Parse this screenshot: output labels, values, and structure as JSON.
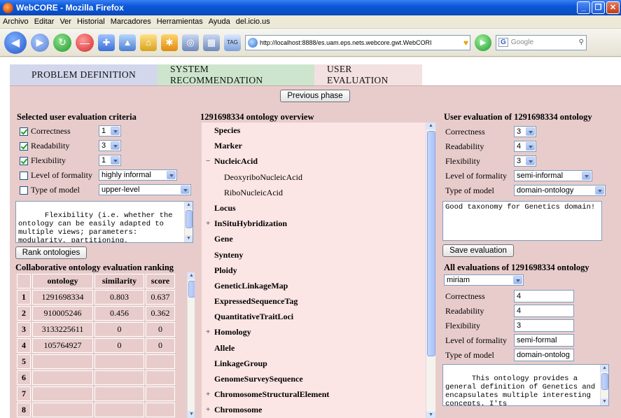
{
  "window": {
    "title": "WebCORE - Mozilla Firefox",
    "menu": [
      "Archivo",
      "Editar",
      "Ver",
      "Historial",
      "Marcadores",
      "Herramientas",
      "Ayuda",
      "del.icio.us"
    ],
    "url": "http://localhost:8888/es.uam.eps.nets.webcore.gwt.WebCORI",
    "search_placeholder": "Google",
    "tag_label": "TAG"
  },
  "tabs": [
    "PROBLEM DEFINITION",
    "SYSTEM RECOMMENDATION",
    "USER EVALUATION"
  ],
  "prev_button": "Previous phase",
  "criteria": {
    "heading": "Selected user evaluation criteria",
    "items": [
      {
        "label": "Correctness",
        "checked": true,
        "value": "1"
      },
      {
        "label": "Readability",
        "checked": true,
        "value": "3"
      },
      {
        "label": "Flexibility",
        "checked": true,
        "value": "1"
      },
      {
        "label": "Level of formality",
        "checked": false,
        "value": "highly informal"
      },
      {
        "label": "Type of model",
        "checked": false,
        "value": "upper-level"
      }
    ],
    "description": "Flexibility (i.e. whether the ontology can be easily adapted to multiple views; parameters: modularity, partitioning,",
    "rank_button": "Rank ontologies"
  },
  "ranking": {
    "heading": "Collaborative ontology evaluation ranking",
    "columns": [
      "ontology",
      "similarity",
      "score"
    ],
    "rows": [
      {
        "n": "1",
        "ontology": "1291698334",
        "similarity": "0.803",
        "score": "0.637"
      },
      {
        "n": "2",
        "ontology": "910005246",
        "similarity": "0.456",
        "score": "0.362"
      },
      {
        "n": "3",
        "ontology": "3133225611",
        "similarity": "0",
        "score": "0"
      },
      {
        "n": "4",
        "ontology": "105764927",
        "similarity": "0",
        "score": "0"
      },
      {
        "n": "5",
        "ontology": "",
        "similarity": "",
        "score": ""
      },
      {
        "n": "6",
        "ontology": "",
        "similarity": "",
        "score": ""
      },
      {
        "n": "7",
        "ontology": "",
        "similarity": "",
        "score": ""
      },
      {
        "n": "8",
        "ontology": "",
        "similarity": "",
        "score": ""
      }
    ]
  },
  "overview": {
    "heading": "1291698334 ontology overview",
    "items": [
      {
        "label": "Species",
        "bold": true,
        "indent": 0,
        "expander": ""
      },
      {
        "label": "Marker",
        "bold": true,
        "indent": 0,
        "expander": ""
      },
      {
        "label": "NucleicAcid",
        "bold": true,
        "indent": 0,
        "expander": "−"
      },
      {
        "label": "DeoxyriboNucleicAcid",
        "bold": false,
        "indent": 1,
        "expander": ""
      },
      {
        "label": "RiboNucleicAcid",
        "bold": false,
        "indent": 1,
        "expander": ""
      },
      {
        "label": "Locus",
        "bold": true,
        "indent": 0,
        "expander": ""
      },
      {
        "label": "InSituHybridization",
        "bold": true,
        "indent": 0,
        "expander": "+"
      },
      {
        "label": "Gene",
        "bold": true,
        "indent": 0,
        "expander": ""
      },
      {
        "label": "Synteny",
        "bold": true,
        "indent": 0,
        "expander": ""
      },
      {
        "label": "Ploidy",
        "bold": true,
        "indent": 0,
        "expander": ""
      },
      {
        "label": "GeneticLinkageMap",
        "bold": true,
        "indent": 0,
        "expander": ""
      },
      {
        "label": "ExpressedSequenceTag",
        "bold": true,
        "indent": 0,
        "expander": ""
      },
      {
        "label": "QuantitativeTraitLoci",
        "bold": true,
        "indent": 0,
        "expander": ""
      },
      {
        "label": "Homology",
        "bold": true,
        "indent": 0,
        "expander": "+"
      },
      {
        "label": "Allele",
        "bold": true,
        "indent": 0,
        "expander": ""
      },
      {
        "label": "LinkageGroup",
        "bold": true,
        "indent": 0,
        "expander": ""
      },
      {
        "label": "GenomeSurveySequence",
        "bold": true,
        "indent": 0,
        "expander": ""
      },
      {
        "label": "ChromosomeStructuralElement",
        "bold": true,
        "indent": 0,
        "expander": "+"
      },
      {
        "label": "Chromosome",
        "bold": true,
        "indent": 0,
        "expander": "+"
      }
    ]
  },
  "user_eval": {
    "heading": "User evaluation of 1291698334 ontology",
    "fields": [
      {
        "label": "Correctness",
        "value": "3"
      },
      {
        "label": "Readability",
        "value": "4"
      },
      {
        "label": "Flexibility",
        "value": "3"
      },
      {
        "label": "Level of formality",
        "value": "semi-informal"
      },
      {
        "label": "Type of model",
        "value": "domain-ontology"
      }
    ],
    "comment": "Good taxonomy for Genetics domain!",
    "save_button": "Save evaluation"
  },
  "all_evals": {
    "heading": "All evaluations of 1291698334 ontology",
    "user": "miriam",
    "fields": [
      {
        "label": "Correctness",
        "value": "4"
      },
      {
        "label": "Readability",
        "value": "4"
      },
      {
        "label": "Flexibility",
        "value": "3"
      },
      {
        "label": "Level of formality",
        "value": "semi-formal"
      },
      {
        "label": "Type of model",
        "value": "domain-ontolog"
      }
    ],
    "comment": "This ontology provides a general definition of Genetics and encapsulates multiple interesting concepts. I'ts"
  }
}
